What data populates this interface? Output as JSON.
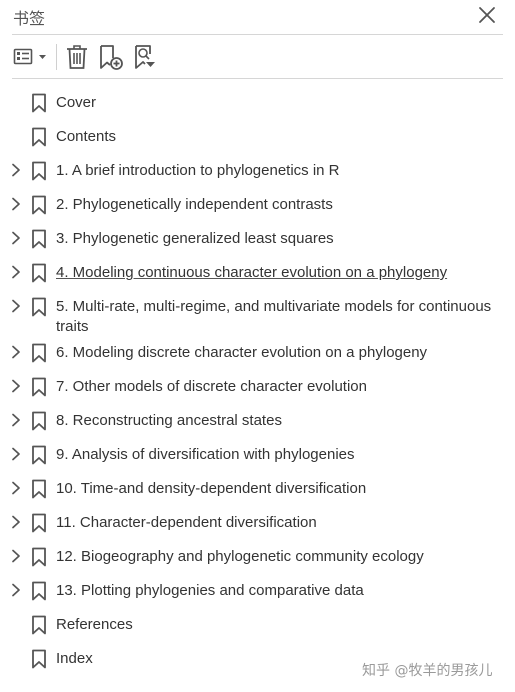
{
  "panel": {
    "title": "书签"
  },
  "icons": {
    "close": "close-icon",
    "options": "options-menu-icon",
    "delete": "trash-icon",
    "new_bookmark": "new-bookmark-icon",
    "find_bookmark": "find-current-bookmark-icon",
    "bookmark": "bookmark-icon",
    "chevron": "chevron-right-icon"
  },
  "bookmarks": [
    {
      "label": "Cover",
      "expandable": false
    },
    {
      "label": "Contents",
      "expandable": false
    },
    {
      "label": "1. A brief introduction to phylogenetics in R",
      "expandable": true
    },
    {
      "label": "2. Phylogenetically independent contrasts",
      "expandable": true
    },
    {
      "label": "3. Phylogenetic generalized least squares",
      "expandable": true
    },
    {
      "label": "4. Modeling continuous character evolution on a phylogeny",
      "expandable": true,
      "hovered": true
    },
    {
      "label": "5. Multi-rate, multi-regime, and multivariate models for continuous traits",
      "expandable": true
    },
    {
      "label": "6. Modeling discrete character evolution on a phylogeny",
      "expandable": true
    },
    {
      "label": "7. Other models of discrete character evolution",
      "expandable": true
    },
    {
      "label": "8. Reconstructing ancestral states",
      "expandable": true
    },
    {
      "label": "9. Analysis of diversification with phylogenies",
      "expandable": true
    },
    {
      "label": "10. Time-and density-dependent diversification",
      "expandable": true
    },
    {
      "label": "11. Character-dependent diversification",
      "expandable": true
    },
    {
      "label": "12. Biogeography and phylogenetic community ecology",
      "expandable": true
    },
    {
      "label": "13. Plotting phylogenies and comparative data",
      "expandable": true
    },
    {
      "label": "References",
      "expandable": false
    },
    {
      "label": "Index",
      "expandable": false
    }
  ],
  "watermark": {
    "text": "知乎 @牧羊的男孩儿"
  },
  "colors": {
    "icon": "#555555",
    "text": "#333333",
    "divider": "#d6d6d6",
    "accent_red": "#d9381e"
  }
}
